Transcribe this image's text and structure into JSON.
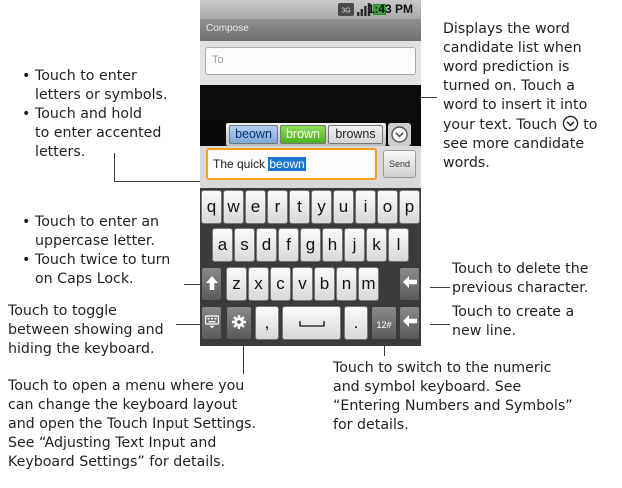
{
  "callouts": {
    "candidate_list": [
      "Displays the word",
      "candidate list when",
      "word prediction is",
      "turned on. Touch a",
      "word to insert it into",
      "your text. Touch",
      "to",
      "see more candidate",
      "words."
    ],
    "letters": {
      "b1_l1": "Touch to enter",
      "b1_l2": "letters or symbols.",
      "b2_l1": "Touch and hold",
      "b2_l2": "to enter accented",
      "b2_l3": "letters."
    },
    "shift": {
      "b1_l1": "Touch to enter an",
      "b1_l2": "uppercase letter.",
      "b2_l1": "Touch twice to turn",
      "b2_l2": "on Caps Lock."
    },
    "hide_keyboard": [
      "Touch to toggle",
      "between showing and",
      "hiding the keyboard."
    ],
    "delete": [
      "Touch to delete the",
      "previous character."
    ],
    "enter": [
      "Touch to create a",
      "new line."
    ],
    "menu": [
      "Touch to open a menu where you",
      "can change the keyboard layout",
      "and open the Touch Input Settings.",
      "See “Adjusting Text Input and",
      "Keyboard Settings” for details."
    ],
    "numeric": [
      "Touch to switch to the numeric",
      "and symbol keyboard. See",
      "“Entering Numbers and Symbols”",
      "for details."
    ]
  },
  "phone": {
    "status_time": "1:43 PM",
    "title": "Compose",
    "to_placeholder": "To",
    "candidates": [
      "beown",
      "brown",
      "browns"
    ],
    "message_prefix": "The quick ",
    "message_selected": "beown",
    "send_label": "Send",
    "keys": {
      "row1": [
        "q",
        "w",
        "e",
        "r",
        "t",
        "y",
        "u",
        "i",
        "o",
        "p"
      ],
      "row2": [
        "a",
        "s",
        "d",
        "f",
        "g",
        "h",
        "j",
        "k",
        "l"
      ],
      "row3": [
        "z",
        "x",
        "c",
        "v",
        "b",
        "n",
        "m"
      ],
      "comma": ",",
      "period": ".",
      "numeric_label": "12#"
    }
  },
  "icons": {
    "more_candidates": "circle-chevron-down-icon",
    "shift": "up-arrow-icon",
    "delete": "left-arrow-icon",
    "enter": "return-arrow-icon",
    "hide_keyboard": "keyboard-icon",
    "settings": "gear-icon",
    "space": "space-bar-icon"
  }
}
